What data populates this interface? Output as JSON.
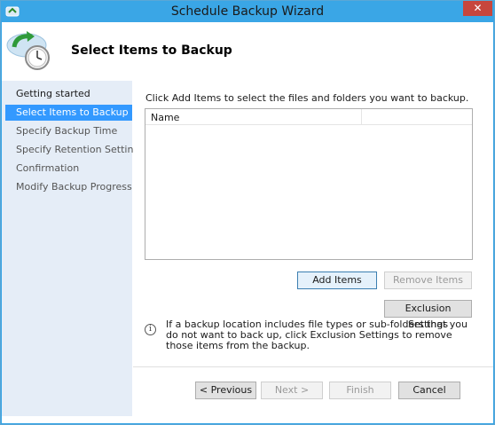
{
  "window": {
    "title": "Schedule Backup Wizard",
    "close_glyph": "✕"
  },
  "header": {
    "title": "Select Items to Backup",
    "icon": "backup-clock-icon"
  },
  "nav": {
    "items": [
      {
        "label": "Getting started",
        "state": "normal"
      },
      {
        "label": "Select Items to Backup",
        "state": "active"
      },
      {
        "label": "Specify Backup Time",
        "state": "normal"
      },
      {
        "label": "Specify Retention Setting",
        "state": "normal"
      },
      {
        "label": "Confirmation",
        "state": "normal"
      },
      {
        "label": "Modify Backup Progress",
        "state": "normal"
      }
    ]
  },
  "content": {
    "instruction": "Click Add Items to select the files and folders you want to backup.",
    "list": {
      "columns": [
        "Name",
        ""
      ],
      "rows": []
    },
    "add_items": "Add Items",
    "remove_items": "Remove Items",
    "exclusion_settings": "Exclusion Settings",
    "info_text": "If a backup location includes file types or sub-folders that you do not want to back up, click Exclusion Settings to remove those items from the backup."
  },
  "footer": {
    "previous": "< Previous",
    "next": "Next >",
    "finish": "Finish",
    "cancel": "Cancel"
  },
  "colors": {
    "titlebar": "#3aa6e6",
    "nav_bg": "#e5edf7",
    "nav_active": "#3399ff",
    "close_button": "#c7463d"
  }
}
